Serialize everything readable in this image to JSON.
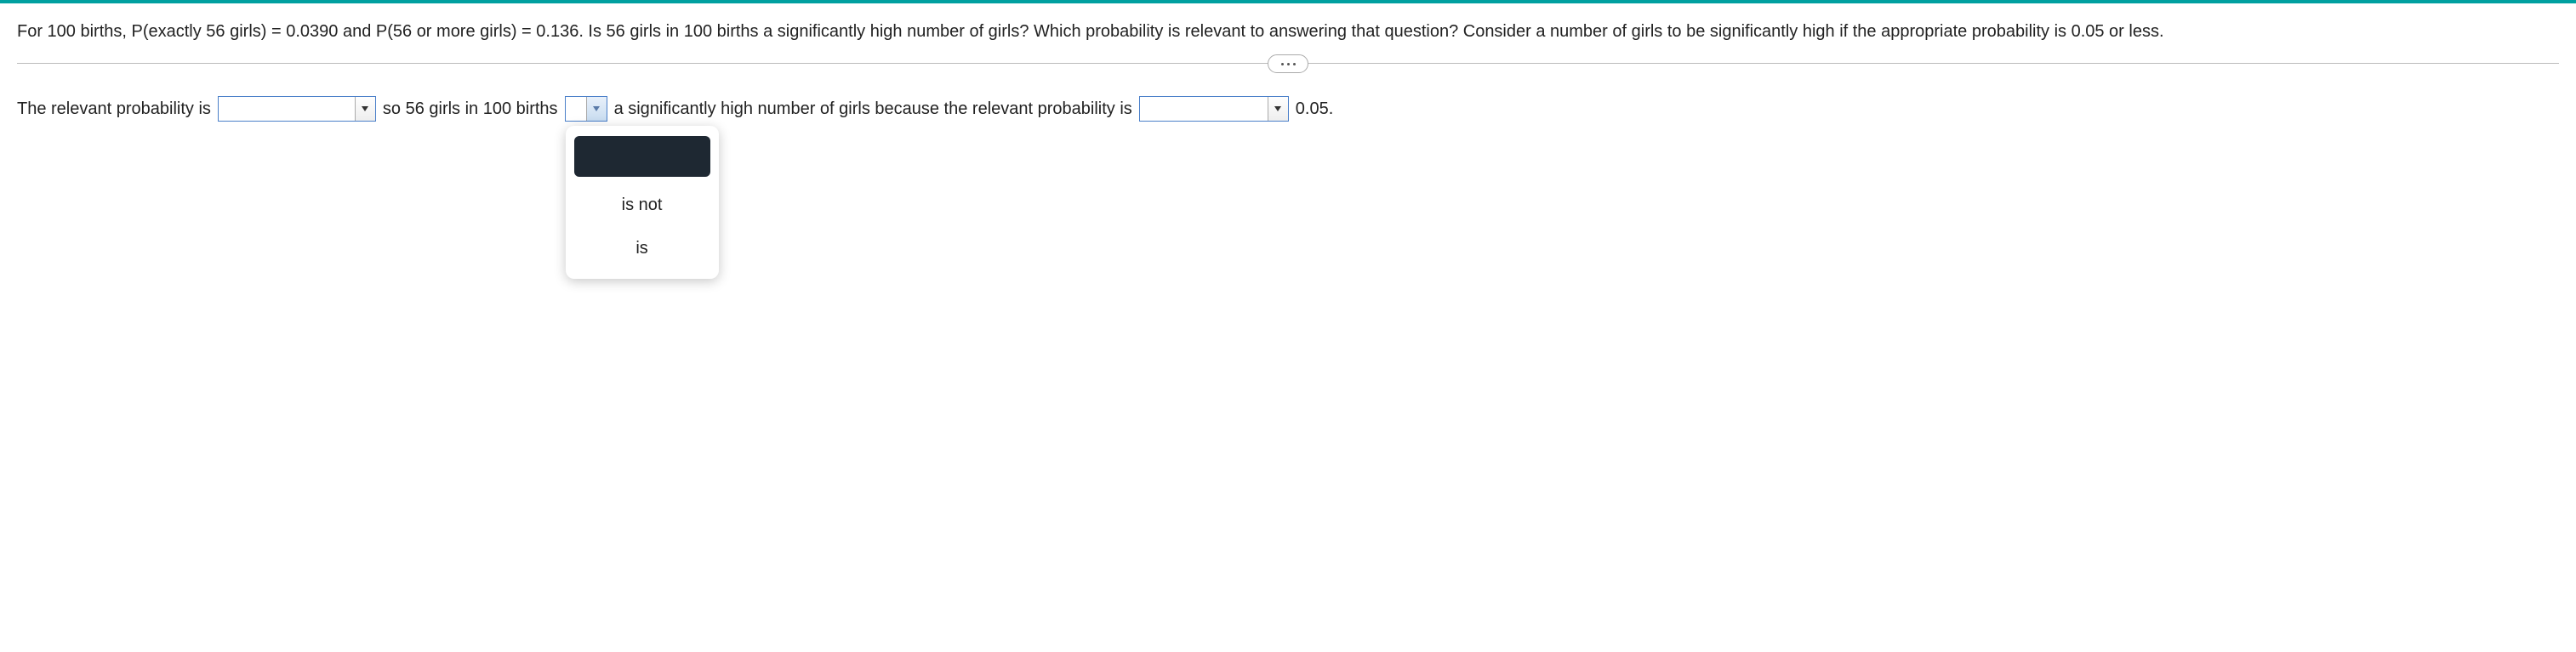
{
  "question": {
    "text": "For 100 births, P(exactly 56 girls) = 0.0390 and P(56 or more girls) = 0.136. Is 56 girls in 100 births a significantly high number of girls? Which probability is relevant to answering that question? Consider a number of girls to be significantly high if the appropriate probability is 0.05 or less."
  },
  "answer": {
    "part1": "The relevant probability is",
    "dropdown1_value": "",
    "part2": "so 56 girls in 100 births",
    "dropdown2_value": "",
    "dropdown2_options": {
      "opt1": "is not",
      "opt2": "is"
    },
    "part3": "a significantly high number of girls because the relevant probability is",
    "dropdown3_value": "",
    "part4": "0.05."
  }
}
